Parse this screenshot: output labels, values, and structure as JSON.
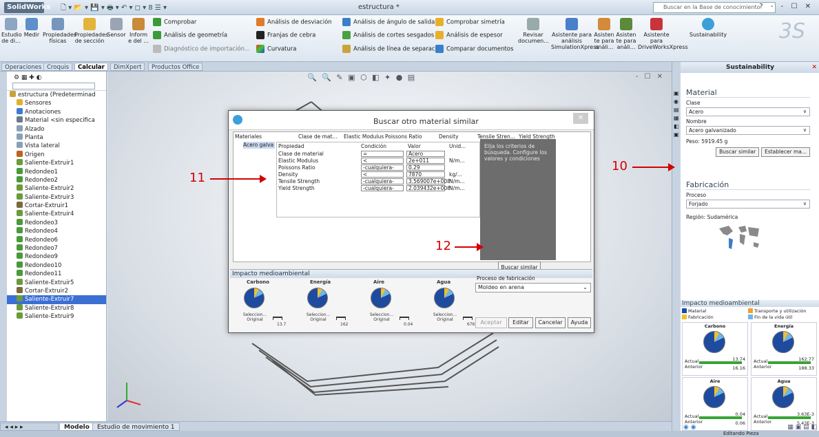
{
  "app": {
    "logo": "SolidWorks",
    "title": "estructura *",
    "search_placeholder": "Buscar en la Base de conocimiento",
    "window_controls": "? - - ☐ ✕"
  },
  "ribbon": {
    "big": [
      "Estudio de di...",
      "Medir",
      "Propiedades físicas",
      "Propiedades de sección",
      "Sensor",
      "Inform e del ..."
    ],
    "col1": [
      "Comprobar",
      "Análisis de geometría",
      "Diagnóstico de importación..."
    ],
    "col2": [
      "Análisis de desviación",
      "Franjas de cebra",
      "Curvatura"
    ],
    "col3": [
      "Análisis de ángulo de salida",
      "Análisis de cortes sesgados",
      "Análisis de línea de separación"
    ],
    "col4": [
      "Comprobar simetría",
      "Análisis de espesor",
      "Comparar documentos"
    ],
    "right": [
      "Revisar documen...",
      "Asistente para análisis SimulationXpress",
      "Asisten te para análi...",
      "Asisten te para análi...",
      "Asistente para DriveWorksXpress",
      "Sustainability"
    ]
  },
  "tabs": [
    "Operaciones",
    "Croquis",
    "Calcular",
    "DimXpert",
    "Productos Office"
  ],
  "active_tab": "Calcular",
  "tree": [
    {
      "label": "estructura  (Predeterminad",
      "c": "#c9a23a"
    },
    {
      "label": "Sensores",
      "c": "#e0b030"
    },
    {
      "label": "Anotaciones",
      "c": "#3d7bd0"
    },
    {
      "label": "Material <sin especifica",
      "c": "#6a7a8a"
    },
    {
      "label": "Alzado",
      "c": "#8aa0b8"
    },
    {
      "label": "Planta",
      "c": "#8aa0b8"
    },
    {
      "label": "Vista lateral",
      "c": "#8aa0b8"
    },
    {
      "label": "Origen",
      "c": "#c06020"
    },
    {
      "label": "Saliente-Extruir1",
      "c": "#6b9b3a"
    },
    {
      "label": "Redondeo1",
      "c": "#4a9a3a"
    },
    {
      "label": "Redondeo2",
      "c": "#4a9a3a"
    },
    {
      "label": "Saliente-Extruir2",
      "c": "#6b9b3a"
    },
    {
      "label": "Saliente-Extruir3",
      "c": "#6b9b3a"
    },
    {
      "label": "Cortar-Extruir1",
      "c": "#7a6a3a"
    },
    {
      "label": "Saliente-Extruir4",
      "c": "#6b9b3a"
    },
    {
      "label": "Redondeo3",
      "c": "#4a9a3a"
    },
    {
      "label": "Redondeo4",
      "c": "#4a9a3a"
    },
    {
      "label": "Redondeo6",
      "c": "#4a9a3a"
    },
    {
      "label": "Redondeo7",
      "c": "#4a9a3a"
    },
    {
      "label": "Redondeo9",
      "c": "#4a9a3a"
    },
    {
      "label": "Redondeo10",
      "c": "#4a9a3a"
    },
    {
      "label": "Redondeo11",
      "c": "#4a9a3a"
    },
    {
      "label": "Saliente-Extruir5",
      "c": "#6b9b3a"
    },
    {
      "label": "Cortar-Extruir2",
      "c": "#7a6a3a"
    },
    {
      "label": "Saliente-Extruir7",
      "c": "#6b9b3a",
      "sel": true
    },
    {
      "label": "Saliente-Extruir8",
      "c": "#6b9b3a"
    },
    {
      "label": "Saliente-Extruir9",
      "c": "#6b9b3a"
    }
  ],
  "bottom_tabs": [
    "Modelo",
    "Estudio de movimiento 1"
  ],
  "status": "Editando Pieza",
  "dialog": {
    "title": "Buscar otro material similar",
    "headers": [
      "Materiales",
      "Clase de mat...",
      "Elastic Modulus",
      "Poissons Ratio",
      "Density",
      "Tensile Stren...",
      "Yield Strength"
    ],
    "material_row": "Acero galva",
    "crit_headers": [
      "Propiedad",
      "Condición",
      "Valor",
      "Unid..."
    ],
    "crit_rows": [
      {
        "p": "Clase de material",
        "c": "=",
        "v": "Acero",
        "u": ""
      },
      {
        "p": "Elastic Modulus",
        "c": "<",
        "v": "2e+011",
        "u": "N/m..."
      },
      {
        "p": "Poissons Ratio",
        "c": "-cualquiera-",
        "v": "0.29",
        "u": ""
      },
      {
        "p": "Density",
        "c": "<",
        "v": "7870",
        "u": "kg/..."
      },
      {
        "p": "Tensile Strength",
        "c": "-cualquiera-",
        "v": "3.569007e+008",
        "u": "N/m..."
      },
      {
        "p": "Yield Strength",
        "c": "-cualquiera-",
        "v": "2.039432e+008",
        "u": "N/m..."
      }
    ],
    "help": "Elija los criterios de búsqueda. Configure los valores y condiciones",
    "search_btn": "Buscar similar",
    "impact_title": "Impacto medioambiental",
    "pies": [
      {
        "name": "Carbono",
        "sub": "Seleccion... Original",
        "bar": "13.7"
      },
      {
        "name": "Energía",
        "sub": "Seleccion... Original",
        "bar": "162"
      },
      {
        "name": "Aire",
        "sub": "Seleccion... Original",
        "bar": "0.04"
      },
      {
        "name": "Agua",
        "sub": "Seleccion... Original",
        "bar": "676"
      }
    ],
    "process_label": "Proceso de fabricación",
    "process_value": "Moldeo en arena",
    "buttons": [
      "Aceptar",
      "Editar",
      "Cancelar",
      "Ayuda"
    ]
  },
  "sustain": {
    "title": "Sustainability",
    "material_head": "Material",
    "clase_label": "Clase",
    "clase_value": "Acero",
    "nombre_label": "Nombre",
    "nombre_value": "Acero galvanizado",
    "peso": "Peso:  5919.45 g",
    "btn1": "Buscar similar",
    "btn2": "Establecer ma...",
    "fab_head": "Fabricación",
    "proceso_label": "Proceso",
    "proceso_value": "Forjado",
    "region": "Región:  Sudamérica",
    "impact_head": "Impacto medioambiental",
    "legend": [
      "Material",
      "Transporte y utilización",
      "Fabricación",
      "Fin de la vida útil"
    ],
    "cells": [
      {
        "name": "Carbono",
        "av": "13.74",
        "bv": "16.16"
      },
      {
        "name": "Energía",
        "av": "162.77",
        "bv": "188.33"
      },
      {
        "name": "Aire",
        "av": "0.04",
        "bv": "0.06"
      },
      {
        "name": "Agua",
        "av": "3.63E-3",
        "bv": "5.43E-3"
      }
    ],
    "actual": "Actual",
    "anterior": "Anterior"
  },
  "annotations": {
    "a10": "10",
    "a11": "11",
    "a12": "12"
  }
}
